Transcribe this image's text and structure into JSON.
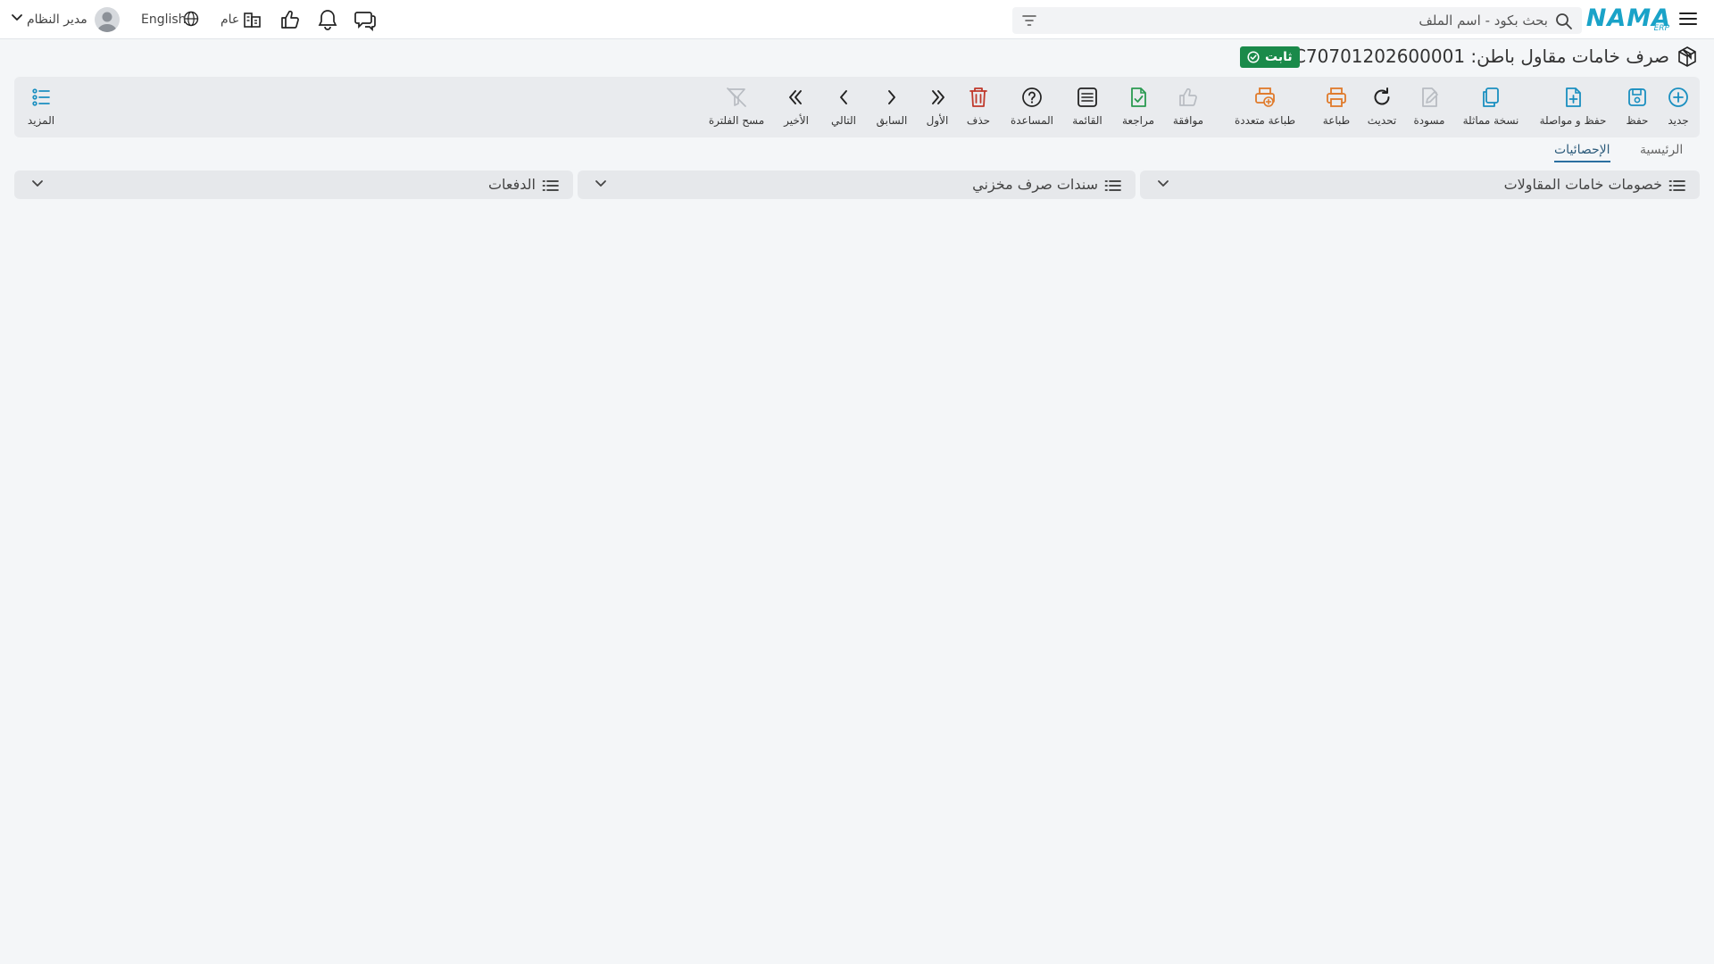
{
  "topbar": {
    "search_placeholder": "بحث بكود - اسم الملف",
    "logo_text": "NAMA",
    "logo_sub": "ERP",
    "user_name": "مدير النظام",
    "language": "English",
    "branch": "عام"
  },
  "document": {
    "title": "صرف خامات مقاول باطن: CMIC70701202600001",
    "status": "ثابت"
  },
  "toolbar": {
    "new": "جديد",
    "save": "حفظ",
    "save_continue": "حفظ و مواصلة",
    "duplicate": "نسخة مماثلة",
    "draft": "مسودة",
    "refresh": "تحديث",
    "print": "طباعة",
    "multi_print": "طباعة متعددة",
    "approve": "موافقة",
    "review": "مراجعة",
    "list": "القائمة",
    "help": "المساعدة",
    "delete": "حذف",
    "first": "الأول",
    "previous": "السابق",
    "next": "التالي",
    "last": "الأخير",
    "clear_filter": "مسح الفلترة",
    "more": "المزيد"
  },
  "tabs": {
    "main": "الرئيسية",
    "stats": "الإحصائيات"
  },
  "panels": {
    "discounts": "خصومات خامات المقاولات",
    "issues": "سندات صرف مخزني",
    "payments": "الدفعات"
  },
  "colors": {
    "accent_blue": "#1a8fc0",
    "status_green": "#1a8a4a",
    "delete_red": "#c0392b",
    "print_orange": "#e07a2a",
    "review_green": "#2a9a50"
  }
}
